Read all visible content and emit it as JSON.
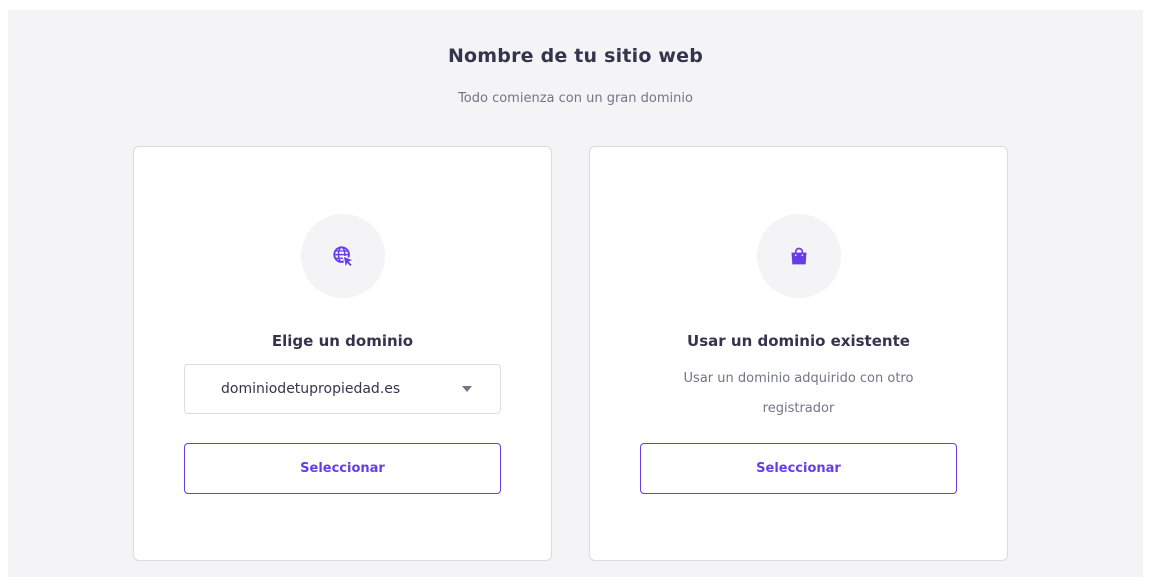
{
  "header": {
    "title": "Nombre de tu sitio web",
    "subtitle": "Todo comienza con un gran dominio"
  },
  "cards": [
    {
      "icon": "globe-cursor-icon",
      "title": "Elige un dominio",
      "select": {
        "value": "dominiodetupropiedad.es"
      },
      "button_label": "Seleccionar"
    },
    {
      "icon": "shopping-bag-icon",
      "title": "Usar un dominio existente",
      "description": "Usar un dominio adquirido con otro registrador",
      "button_label": "Seleccionar"
    }
  ],
  "colors": {
    "accent": "#673de6",
    "background": "#f4f4f6",
    "title_text": "#36344d",
    "muted_text": "#727586"
  }
}
